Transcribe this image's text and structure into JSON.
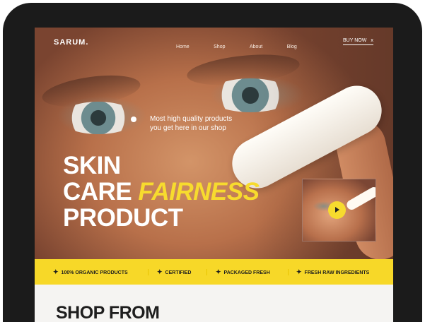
{
  "brand": {
    "logo": "SARUM."
  },
  "nav": {
    "links": [
      "Home",
      "Shop",
      "About",
      "Blog"
    ],
    "cta": "BUY NOW",
    "cta_icon": "x"
  },
  "hero": {
    "tagline": "Most high quality products you get here in our shop",
    "headline_line1": "SKIN",
    "headline_line2_prefix": "CARE",
    "headline_line2_accent": "FAIRNESS",
    "headline_line3": "PRODUCT",
    "accent_color": "#f7db2e"
  },
  "video": {
    "play_icon": "play-icon"
  },
  "features": [
    "100% ORGANIC PRODUCTS",
    "CERTIFIED",
    "PACKAGED FRESH",
    "FRESH RAW INGREDIENTS"
  ],
  "features_icon": "sparkle-icon",
  "section": {
    "title": "SHOP FROM"
  },
  "colors": {
    "strip": "#f7d828",
    "device": "#1b1b1b",
    "text_dark": "#1e1e1e"
  }
}
